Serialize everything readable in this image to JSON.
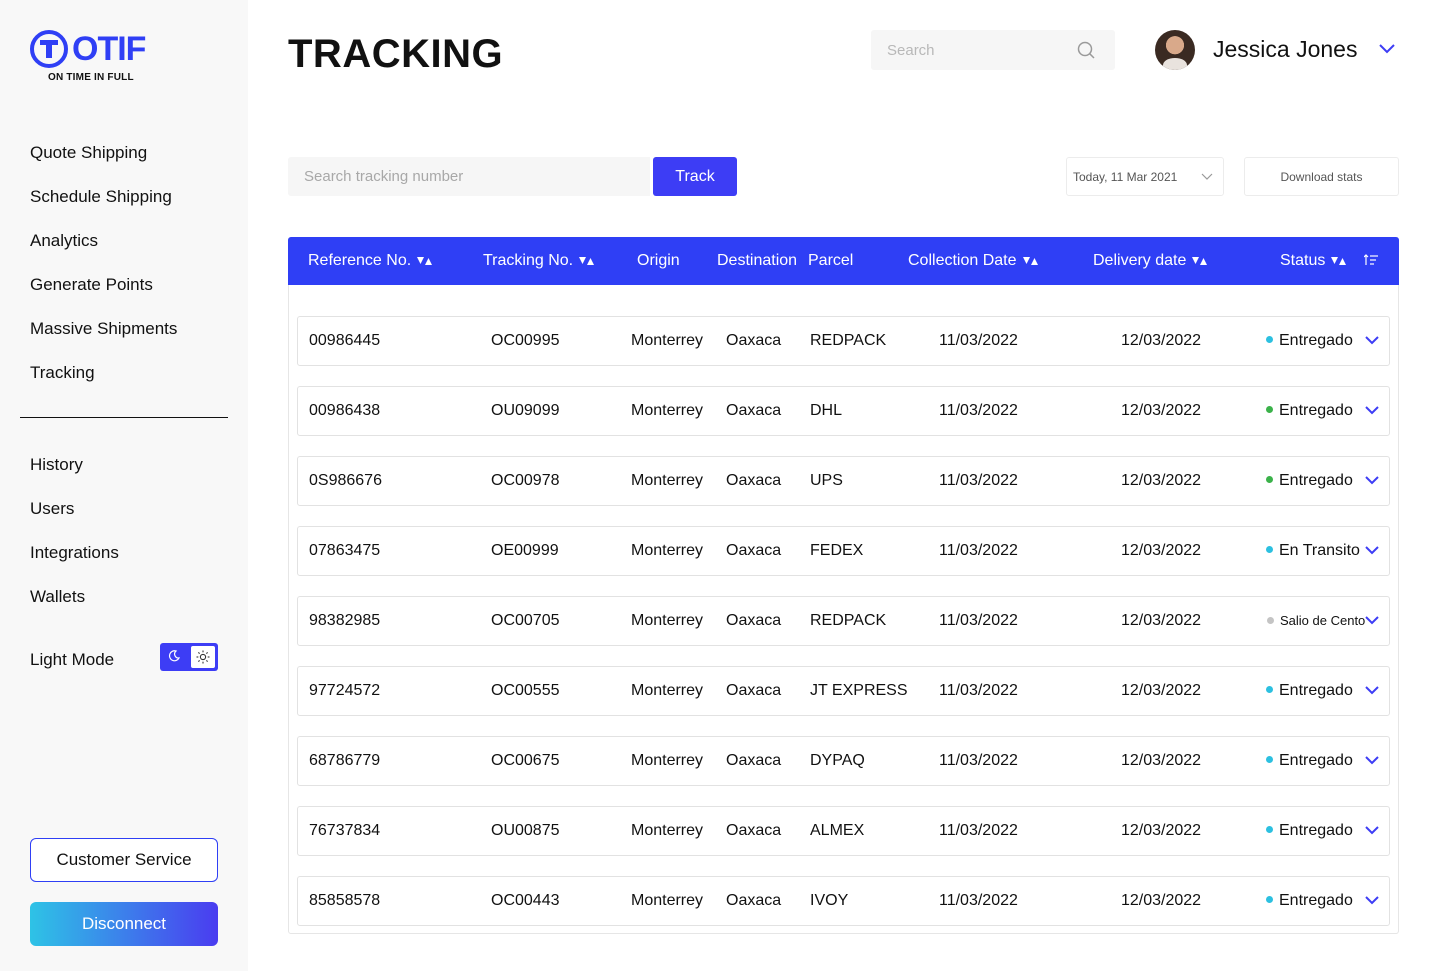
{
  "brand": {
    "name": "OTIF",
    "tagline": "ON TIME IN FULL",
    "accent": "#2f3ff5"
  },
  "sidebar": {
    "main_items": [
      {
        "label": "Quote Shipping"
      },
      {
        "label": "Schedule Shipping"
      },
      {
        "label": "Analytics"
      },
      {
        "label": "Generate Points"
      },
      {
        "label": "Massive Shipments"
      },
      {
        "label": "Tracking"
      }
    ],
    "secondary_items": [
      {
        "label": "History"
      },
      {
        "label": "Users"
      },
      {
        "label": "Integrations"
      },
      {
        "label": "Wallets"
      }
    ],
    "light_mode_label": "Light Mode",
    "customer_service_label": "Customer Service",
    "disconnect_label": "Disconnect"
  },
  "header": {
    "title": "TRACKING",
    "search_placeholder": "Search",
    "user_name": "Jessica Jones"
  },
  "toolbar": {
    "tracking_placeholder": "Search tracking number",
    "track_label": "Track",
    "date_value": "Today, 11 Mar 2021",
    "download_label": "Download stats"
  },
  "table": {
    "columns": {
      "reference": "Reference No.",
      "tracking": "Tracking No.",
      "origin": "Origin",
      "destination": "Destination",
      "parcel": "Parcel",
      "collection": "Collection Date",
      "delivery": "Delivery date",
      "status": "Status"
    },
    "status_colors": {
      "Entregado": "#2cc0e0",
      "En Transito": "#2cc0e0",
      "Salio de Cento": "#c4c4c4"
    },
    "rows": [
      {
        "reference": "00986445",
        "tracking": "OC00995",
        "origin": "Monterrey",
        "destination": "Oaxaca",
        "parcel": "REDPACK",
        "collection": "11/03/2022",
        "delivery": "12/03/2022",
        "status": "Entregado",
        "status_color": "#2cc0e0"
      },
      {
        "reference": "00986438",
        "tracking": "OU09099",
        "origin": "Monterrey",
        "destination": "Oaxaca",
        "parcel": "DHL",
        "collection": "11/03/2022",
        "delivery": "12/03/2022",
        "status": "Entregado",
        "status_color": "#3bb24a"
      },
      {
        "reference": "0S986676",
        "tracking": "OC00978",
        "origin": "Monterrey",
        "destination": "Oaxaca",
        "parcel": "UPS",
        "collection": "11/03/2022",
        "delivery": "12/03/2022",
        "status": "Entregado",
        "status_color": "#3bb24a"
      },
      {
        "reference": "07863475",
        "tracking": "OE00999",
        "origin": "Monterrey",
        "destination": "Oaxaca",
        "parcel": "FEDEX",
        "collection": "11/03/2022",
        "delivery": "12/03/2022",
        "status": "En Transito",
        "status_color": "#2cc0e0"
      },
      {
        "reference": "98382985",
        "tracking": "OC00705",
        "origin": "Monterrey",
        "destination": "Oaxaca",
        "parcel": "REDPACK",
        "collection": "11/03/2022",
        "delivery": "12/03/2022",
        "status": "Salio de Cento",
        "status_color": "#c4c4c4"
      },
      {
        "reference": "97724572",
        "tracking": "OC00555",
        "origin": "Monterrey",
        "destination": "Oaxaca",
        "parcel": "JT EXPRESS",
        "collection": "11/03/2022",
        "delivery": "12/03/2022",
        "status": "Entregado",
        "status_color": "#2cc0e0"
      },
      {
        "reference": "68786779",
        "tracking": "OC00675",
        "origin": "Monterrey",
        "destination": "Oaxaca",
        "parcel": "DYPAQ",
        "collection": "11/03/2022",
        "delivery": "12/03/2022",
        "status": "Entregado",
        "status_color": "#2cc0e0"
      },
      {
        "reference": "76737834",
        "tracking": "OU00875",
        "origin": "Monterrey",
        "destination": "Oaxaca",
        "parcel": "ALMEX",
        "collection": "11/03/2022",
        "delivery": "12/03/2022",
        "status": "Entregado",
        "status_color": "#2cc0e0"
      },
      {
        "reference": "85858578",
        "tracking": "OC00443",
        "origin": "Monterrey",
        "destination": "Oaxaca",
        "parcel": "IVOY",
        "collection": "11/03/2022",
        "delivery": "12/03/2022",
        "status": "Entregado",
        "status_color": "#2cc0e0"
      }
    ]
  },
  "icons": {
    "search": "search-icon",
    "chevron": "chevron-down-icon",
    "sort": "sort-icon",
    "filter": "filter-icon",
    "moon": "moon-icon",
    "sun": "sun-icon"
  }
}
